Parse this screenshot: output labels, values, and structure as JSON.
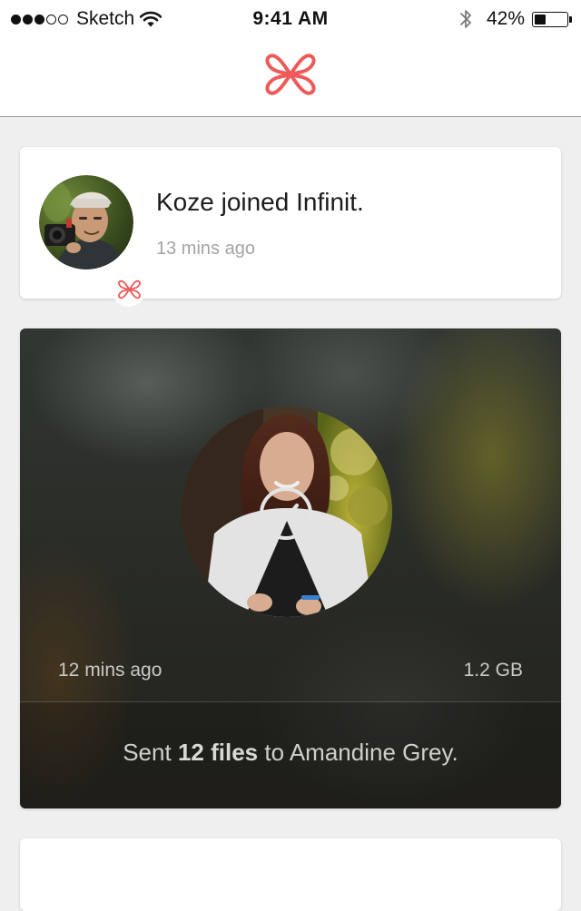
{
  "status_bar": {
    "carrier": "Sketch",
    "signal_bars": 3,
    "signal_max": 5,
    "time": "9:41 AM",
    "battery_text": "42%",
    "battery_level": 0.42,
    "icons": [
      "wifi-icon",
      "bluetooth-icon",
      "battery-icon"
    ]
  },
  "nav": {
    "logo_icon": "infinit-logo-icon",
    "brand_color": "#ee5a5a"
  },
  "feed": {
    "join_event": {
      "avatar": "user-avatar",
      "badge_icon": "infinit-logo-icon",
      "title": "Koze joined Infinit.",
      "time": "13 mins ago"
    },
    "transfer_event": {
      "photo": "recipient-photo",
      "status_icon": "checkmark-icon",
      "time": "12 mins ago",
      "size": "1.2 GB",
      "message_prefix": "Sent",
      "file_count": "12 files",
      "message_middle": "to",
      "recipient": "Amandine Grey."
    }
  },
  "colors": {
    "background": "#efefef",
    "card": "#ffffff",
    "muted_text": "#a4a4a4",
    "transfer_text": "#c9c9c6"
  }
}
